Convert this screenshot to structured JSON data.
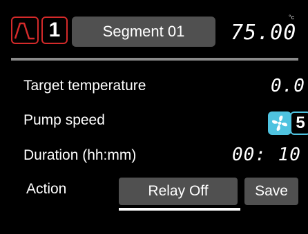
{
  "header": {
    "profile_icon": "temperature-profile-icon",
    "segment_number": "1",
    "segment_label": "Segment 01",
    "current_temperature": "75.00",
    "temperature_unit": "°c"
  },
  "rows": {
    "target_temperature": {
      "label": "Target temperature",
      "value": "0.0"
    },
    "pump_speed": {
      "label": "Pump speed",
      "icon": "fan-icon",
      "value": "5"
    },
    "duration": {
      "label": "Duration (hh:mm)",
      "value": "00: 10"
    },
    "action": {
      "label": "Action",
      "relay_label": "Relay Off",
      "save_label": "Save"
    }
  },
  "colors": {
    "background": "#000000",
    "accent_red": "#d42a2a",
    "accent_cyan": "#4fc3e0",
    "button_gray": "#505050",
    "divider_gray": "#8a8a8a"
  }
}
